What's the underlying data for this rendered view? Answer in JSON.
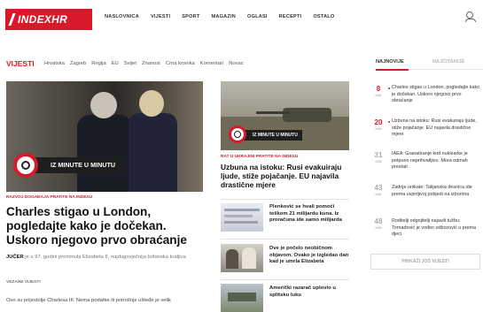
{
  "header": {
    "logo": "INDEXHR",
    "nav": [
      "NASLOVNICA",
      "VIJESTI",
      "SPORT",
      "MAGAZIN",
      "OGLASI",
      "RECEPTI",
      "OSTALO"
    ]
  },
  "section": {
    "title": "VIJESTI",
    "subnav": [
      "Hrvatska",
      "Zagreb",
      "Regija",
      "EU",
      "Svijet",
      "Znanost",
      "Crna kronika",
      "Komentari",
      "Novac"
    ]
  },
  "hero": {
    "banner": "IZ MINUTE U MINUTU",
    "kicker": "RAZVOJ DOGAĐAJA PRATITE NA INDEXU",
    "title": "Charles stigao u London, pogledajte kako je dočekan. Uskoro njegovo prvo obraćanje",
    "summary_lead": "JUČER",
    "summary": "je u 97. godini preminula Elizabeta II, najdugovječnija britanska kraljica",
    "related_label": "VEZANE VIJESTI",
    "related_first": "Ovo su prijestolje Charlesa III. Nema podatke ili potrošnje ušteđe je velik"
  },
  "middle": {
    "banner": "IZ MINUTE U MINUTU",
    "kicker": "RAT U UKRAJINI PRATITE NA INDEXU",
    "title": "Uzbuna na istoku: Rusi evakuiraju ljude, stiže pojačanje. EU najavila drastične mjere",
    "items": [
      "Plenković se hvali pomoći teškom 21 milijardu kuna. Iz proračuna ide samo milijarda",
      "Dve je počelo neobičnom objavom. Ovako je izgledao dan kad je umrla Elizabeta",
      "Američki razarač uplovio u splitsku luku"
    ]
  },
  "right": {
    "tab_latest": "NAJNOVIJE",
    "tab_read": "NAJČITANIJE",
    "news": [
      {
        "num": "8",
        "unit": "MIN",
        "text": "Charles stigao u London, pogledajte kako je dočekan. Uskoro njegovo prvo obraćanje",
        "red": true
      },
      {
        "num": "20",
        "unit": "MIN",
        "text": "Uzbuna na istoku: Rusi evakuiraju ljude, stiže pojačanje. EU najavila drastične mjere",
        "red": true
      },
      {
        "num": "31",
        "unit": "MIN",
        "text": "IAEA: Granatiranje kod nuklearke je potpuno neprihvatljivo. Mora odmah prestati",
        "red": false
      },
      {
        "num": "43",
        "unit": "MIN",
        "text": "Zadnje unikate: Talijanska desnica ide prema uvjerljivoj pobjedi na izborima",
        "red": false
      },
      {
        "num": "48",
        "unit": "MIN",
        "text": "Roditelji odgojitelji najavili tužbu: Tornadović je vođen odbozović u prema djeci",
        "red": false
      }
    ],
    "more": "PRIKAŽI JOŠ VIJESTI"
  }
}
